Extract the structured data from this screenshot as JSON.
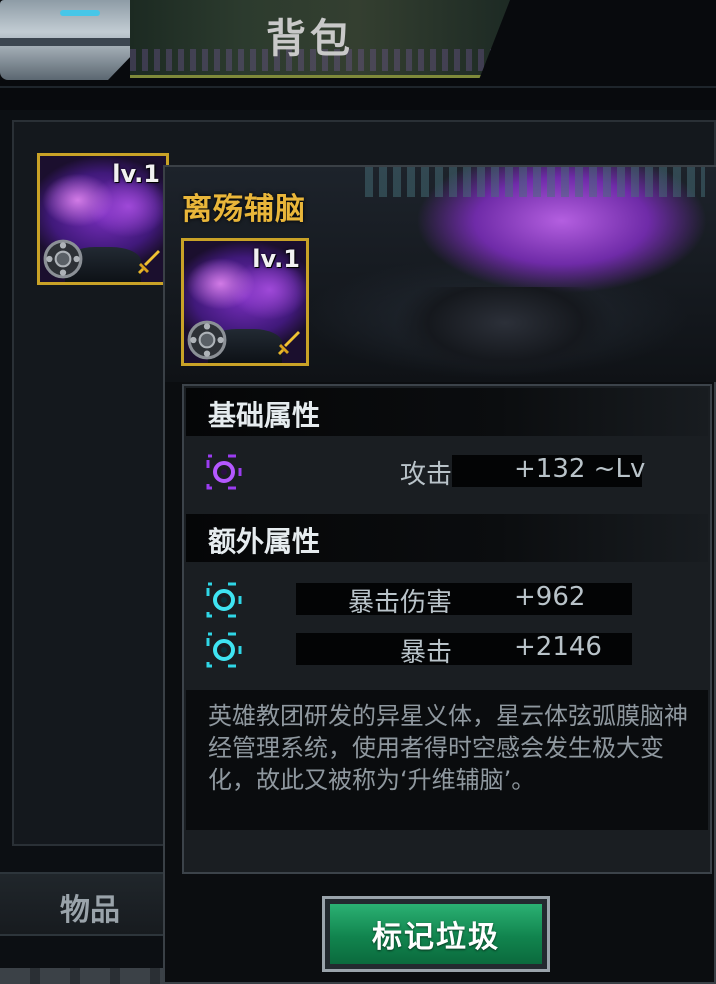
{
  "header": {
    "title": "背包"
  },
  "bag": {
    "slot": {
      "level": "lv.1"
    }
  },
  "tabs": [
    {
      "label": "物品"
    }
  ],
  "detail": {
    "item_name": "离殇辅脑",
    "icon_level": "lv.1",
    "base_section": {
      "title": "基础属性",
      "stats": [
        {
          "label": "攻击",
          "value": "+132 ~Lv"
        }
      ]
    },
    "extra_section": {
      "title": "额外属性",
      "stats": [
        {
          "label": "暴击伤害",
          "value": "+962"
        },
        {
          "label": "暴击",
          "value": "+2146"
        }
      ]
    },
    "description": "英雄教团研发的异星义体，星云体弦弧膜脑神经管理系统，使用者得时空感会发生极大变化，故此又被称为‘升维辅脑’。",
    "mark_button": "标记垃圾"
  },
  "colors": {
    "item_name": "#e9b63a",
    "quality_border": "#c9a227",
    "base_stat_icon": "#9b3cf0",
    "extra_stat_icon": "#2fd6e6",
    "button_green": "#11844e"
  },
  "icons": {
    "gear": "gear-icon",
    "sword": "sword-icon",
    "base_stat": "purple-ring-icon",
    "extra_stat": "cyan-ring-icon"
  }
}
